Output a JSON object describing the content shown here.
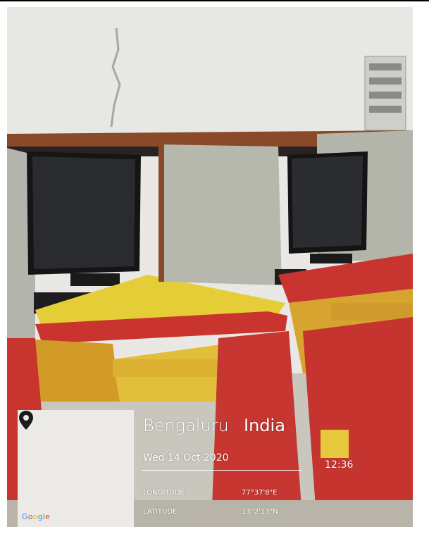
{
  "location": {
    "city": "Bengaluru",
    "country": "India",
    "date": "Wed 14 Oct 2020",
    "time": "12:36",
    "longitude_label": "LONGITUDE",
    "longitude_value": "77°37'8\"E",
    "latitude_label": "LATITUDE",
    "latitude_value": "13°2'13\"N"
  },
  "map": {
    "google_letters": [
      "G",
      "o",
      "o",
      "g",
      "l",
      "e"
    ],
    "pin_icon": "map-pin-icon"
  },
  "colors": {
    "desk_red": "#c8342f",
    "desk_yellow": "#e3c935",
    "partition_gray": "#b7b8ad",
    "wall": "#e6e6e3"
  }
}
